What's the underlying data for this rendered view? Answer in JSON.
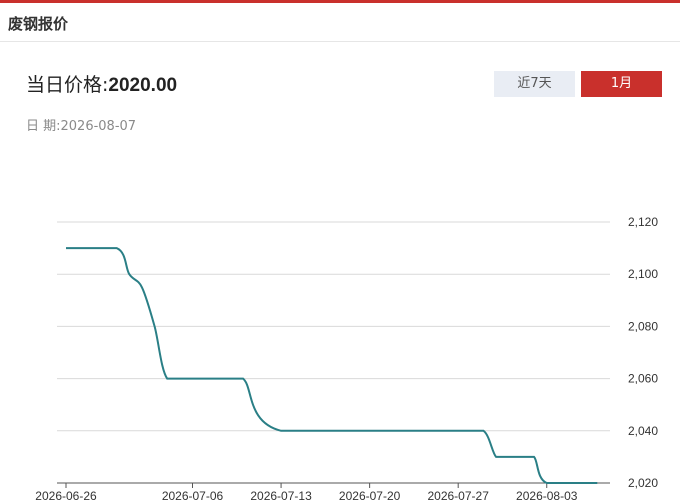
{
  "header": {
    "title": "废钢报价"
  },
  "summary": {
    "price_label": "当日价格:",
    "price_value": "2020.00",
    "date_label": "日 期:",
    "date_value": "2026-08-07"
  },
  "range_buttons": {
    "week_label": "近7天",
    "month_label": "1月",
    "active": "month"
  },
  "colors": {
    "accent": "#c9302c",
    "line": "#2a7f86",
    "grid": "#d9d9d9"
  },
  "chart_data": {
    "type": "line",
    "x": [
      "2026-06-26",
      "2026-06-30",
      "2026-07-01",
      "2026-07-02",
      "2026-07-03",
      "2026-07-04",
      "2026-07-06",
      "2026-07-08",
      "2026-07-10",
      "2026-07-13",
      "2026-07-27",
      "2026-07-29",
      "2026-07-30",
      "2026-07-31",
      "2026-08-01",
      "2026-08-02",
      "2026-08-03",
      "2026-08-07"
    ],
    "series": [
      {
        "values": [
          2110,
          2110,
          2100,
          2095,
          2080,
          2060,
          2060,
          2060,
          2060,
          2040,
          2040,
          2040,
          2030,
          2030,
          2030,
          2030,
          2020,
          2020
        ]
      }
    ],
    "x_ticks": [
      "2026-06-26",
      "2026-07-06",
      "2026-07-13",
      "2026-07-20",
      "2026-07-27",
      "2026-08-03"
    ],
    "y_ticks": [
      "2,020",
      "2,040",
      "2,060",
      "2,080",
      "2,100",
      "2,120"
    ],
    "x_range": [
      "2026-06-26",
      "2026-08-08"
    ],
    "ylim": [
      2020,
      2120
    ],
    "y_axis_position": "right",
    "grid": true,
    "legend": "none"
  }
}
